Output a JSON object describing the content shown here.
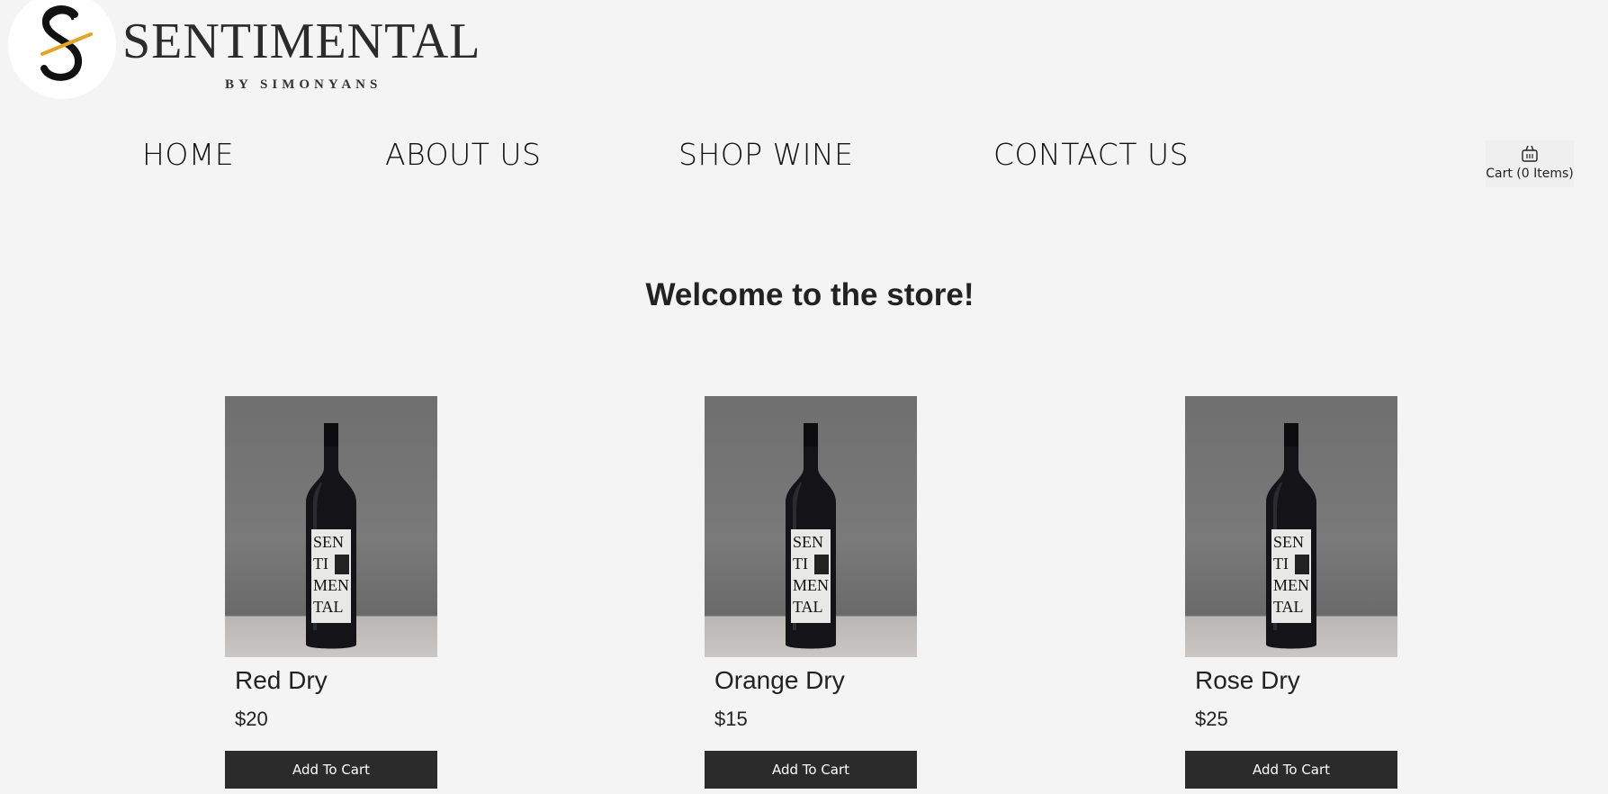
{
  "header": {
    "brand_name": "SENTIMENTAL",
    "brand_sub": "BY SIMONYANS",
    "logo_icon": "s-monogram-logo",
    "accent_color": "#e5a524"
  },
  "nav": {
    "items": [
      {
        "label": "HOME"
      },
      {
        "label": "ABOUT US"
      },
      {
        "label": "SHOP WINE"
      },
      {
        "label": "CONTACT US"
      }
    ]
  },
  "cart": {
    "icon": "basket-icon",
    "label": "Cart (0 Items)"
  },
  "main": {
    "heading": "Welcome to the store!"
  },
  "products": [
    {
      "name": "Red Dry",
      "price": "$20",
      "button_label": "Add To Cart",
      "image": "wine-bottle-image"
    },
    {
      "name": "Orange Dry",
      "price": "$15",
      "button_label": "Add To Cart",
      "image": "wine-bottle-image"
    },
    {
      "name": "Rose Dry",
      "price": "$25",
      "button_label": "Add To Cart",
      "image": "wine-bottle-image"
    }
  ]
}
